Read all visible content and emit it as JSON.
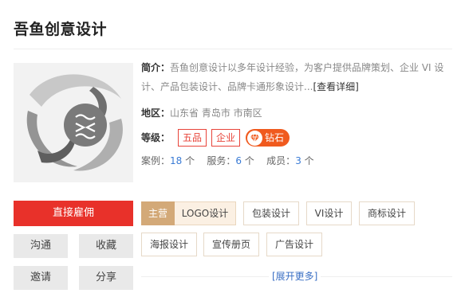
{
  "studio": {
    "name": "吾鱼创意设计"
  },
  "intro": {
    "label": "简介：",
    "text": "吾鱼创意设计以多年设计经验，为客户提供品牌策划、企业 VI 设计、产品包装设计、品牌卡通形象设计...",
    "link": "[查看详细]"
  },
  "region": {
    "label": "地区：",
    "value": "山东省 青岛市 市南区"
  },
  "level": {
    "label": "等级：",
    "tags": [
      "五品",
      "企业"
    ],
    "badge": "钻石"
  },
  "stats": {
    "cases_label": "案例：",
    "cases": "18",
    "cases_unit": "个",
    "service_label": "服务：",
    "service": "6",
    "service_unit": "个",
    "members_label": "成员：",
    "members": "3",
    "members_unit": "个"
  },
  "actions": {
    "hire": "直接雇佣",
    "chat": "沟通",
    "favorite": "收藏",
    "invite": "邀请",
    "share": "分享"
  },
  "categories": {
    "main_head": "主营",
    "main": "LOGO设计",
    "items": [
      "包装设计",
      "VI设计",
      "商标设计",
      "海报设计",
      "宣传册页",
      "广告设计"
    ]
  },
  "expand_more": "[展开更多]",
  "colors": {
    "accent_red": "#e8312a",
    "badge_orange": "#f05a1e",
    "link_blue": "#3a6fc4",
    "main_tag": "#d3a978"
  }
}
